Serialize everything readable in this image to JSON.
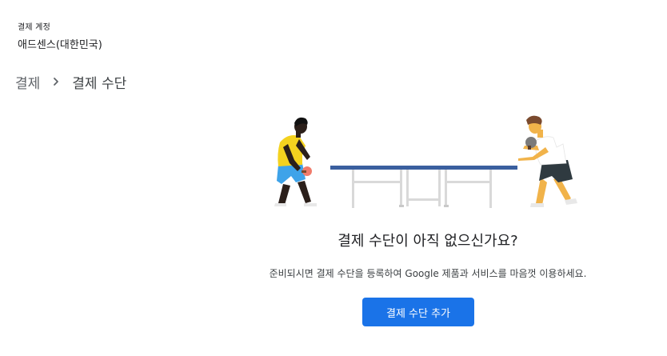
{
  "account": {
    "label": "결제 계정",
    "name": "애드센스(대한민국)"
  },
  "breadcrumb": {
    "parent": "결제",
    "separator_icon": "chevron-right-icon",
    "current": "결제 수단"
  },
  "empty_state": {
    "illustration": "ping-pong-illustration",
    "title": "결제 수단이 아직 없으신가요?",
    "description": "준비되시면 결제 수단을 등록하여 Google 제품과 서비스를 마음껏 이용하세요.",
    "button_label": "결제 수단 추가"
  },
  "colors": {
    "primary_button": "#1a73e8",
    "table_top": "#3a5f9f",
    "table_legs": "#d9d9d9"
  }
}
